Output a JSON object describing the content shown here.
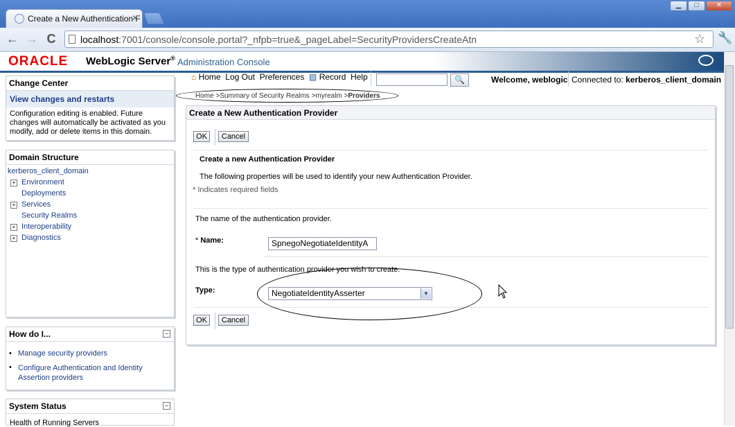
{
  "browser": {
    "tab_title": "Create a New Authentication F",
    "url_host": "localhost",
    "url_rest": ":7001/console/console.portal?_nfpb=true&_pageLabel=SecurityProvidersCreateAtn",
    "back": "←",
    "forward": "→",
    "reload": "C",
    "minimize": "▁",
    "maximize": "□",
    "close": "✕"
  },
  "header": {
    "oracle": "ORACLE",
    "product": "WebLogic Server",
    "reg": "®",
    "console": "Administration Console"
  },
  "change_center": {
    "title": "Change Center",
    "link": "View changes and restarts",
    "text": "Configuration editing is enabled. Future changes will automatically be activated as you modify, add or delete items in this domain."
  },
  "domain_structure": {
    "title": "Domain Structure",
    "domain": "kerberos_client_domain",
    "items": [
      "Environment",
      "Deployments",
      "Services",
      "Security Realms",
      "Interoperability",
      "Diagnostics"
    ]
  },
  "how_do_i": {
    "title": "How do I...",
    "items": [
      "Manage security providers",
      "Configure Authentication and Identity Assertion providers"
    ]
  },
  "system_status": {
    "title": "System Status",
    "sub": "Health of Running Servers"
  },
  "topnav": {
    "home": "Home",
    "logout": "Log Out",
    "preferences": "Preferences",
    "record": "Record",
    "help": "Help",
    "welcome": "Welcome, weblogic",
    "connected_label": "Connected to:",
    "connected_value": "kerberos_client_domain"
  },
  "breadcrumb": {
    "home": "Home",
    "summary": "Summary of Security Realms",
    "realm": "myrealm",
    "current": "Providers",
    "sep": ">"
  },
  "form": {
    "panel_title": "Create a New Authentication Provider",
    "ok": "OK",
    "cancel": "Cancel",
    "heading": "Create a new Authentication Provider",
    "intro": "The following properties will be used to identify your new Authentication Provider.",
    "required_note": "* Indicates required fields",
    "name_desc": "The name of the authentication provider.",
    "name_label": "Name:",
    "name_required": "*",
    "name_value": "SpnegoNegotiateIdentityA",
    "type_desc": "This is the type of authentication provider you wish to create.",
    "type_label": "Type:",
    "type_value": "NegotiateIdentityAsserter"
  },
  "colors": {
    "oracle_red": "#ee0000",
    "link_blue": "#1d3f86",
    "header_blue": "#2b5d93"
  }
}
